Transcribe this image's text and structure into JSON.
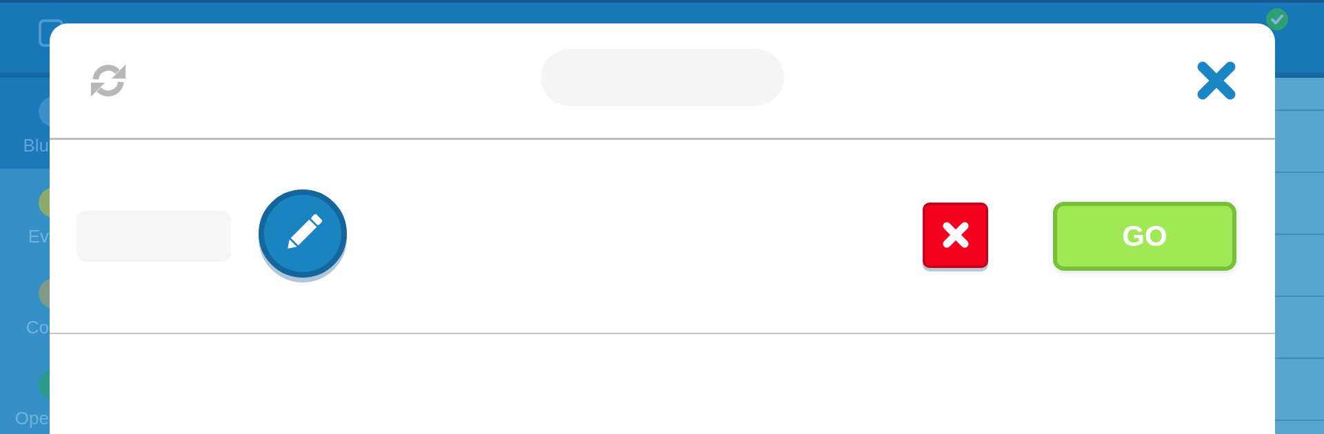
{
  "sidebar": {
    "items": [
      {
        "label": "Blu",
        "color": "#3d8fca",
        "selected": true
      },
      {
        "label": "Ev",
        "color": "#8aab6a",
        "selected": false
      },
      {
        "label": "Co",
        "color": "#7f9a88",
        "selected": false
      },
      {
        "label": "Ope",
        "color": "#2c9a88",
        "selected": false
      }
    ]
  },
  "dialog": {
    "go_button": {
      "label": "GO"
    }
  }
}
